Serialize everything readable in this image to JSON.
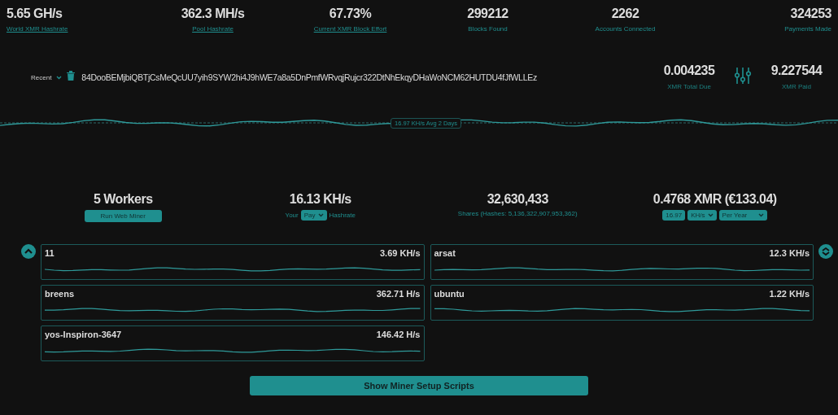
{
  "stats": [
    {
      "value": "5.65 GH/s",
      "label": "World XMR Hashrate",
      "link": true
    },
    {
      "value": "362.3 MH/s",
      "label": "Pool Hashrate",
      "link": true
    },
    {
      "value": "67.73%",
      "label": "Current XMR Block Effort",
      "link": true
    },
    {
      "value": "299212",
      "label": "Blocks Found",
      "link": false
    },
    {
      "value": "2262",
      "label": "Accounts Connected",
      "link": false
    },
    {
      "value": "324253",
      "label": "Payments Made",
      "link": false
    }
  ],
  "address_bar": {
    "recent": "Recent",
    "address": "84DooBEMjbiQBTjCsMeQcUU7yih9SYW2hi4J9hWE7a8a5DnPmfWRvqjRujcr322DtNhEkqyDHaWoNCM62HUTDU4fJfWLLEz"
  },
  "balances": [
    {
      "value": "0.004235",
      "label": "XMR Total Due"
    },
    {
      "value": "9.227544",
      "label": "XMR Paid"
    }
  ],
  "hashrate_chart": {
    "average_label": "16.97 KH/s Avg 2 Days"
  },
  "summary": {
    "workers": "5 Workers",
    "run_button": "Run Web Miner",
    "hashrate": "16.13 KH/s",
    "your": "Your",
    "hashrate_type": "Pay",
    "hashrate_word": "Hashrate",
    "shares": "32,630,433",
    "shares_label": "Shares (Hashes: 5,136,322,907,953,362)",
    "earnings": "0.4768 XMR (€133.04)",
    "calc_rate": "16.97",
    "calc_unit": "KH/s",
    "calc_period": "Per Year"
  },
  "workers": [
    {
      "name": "11",
      "rate": "3.69 KH/s"
    },
    {
      "name": "arsat",
      "rate": "12.3 KH/s"
    },
    {
      "name": "breens",
      "rate": "362.71 H/s"
    },
    {
      "name": "ubuntu",
      "rate": "1.22 KH/s"
    },
    {
      "name": "yos-Inspiron-3647",
      "rate": "146.42 H/s"
    }
  ],
  "setup_button": "Show Miner Setup Scripts"
}
